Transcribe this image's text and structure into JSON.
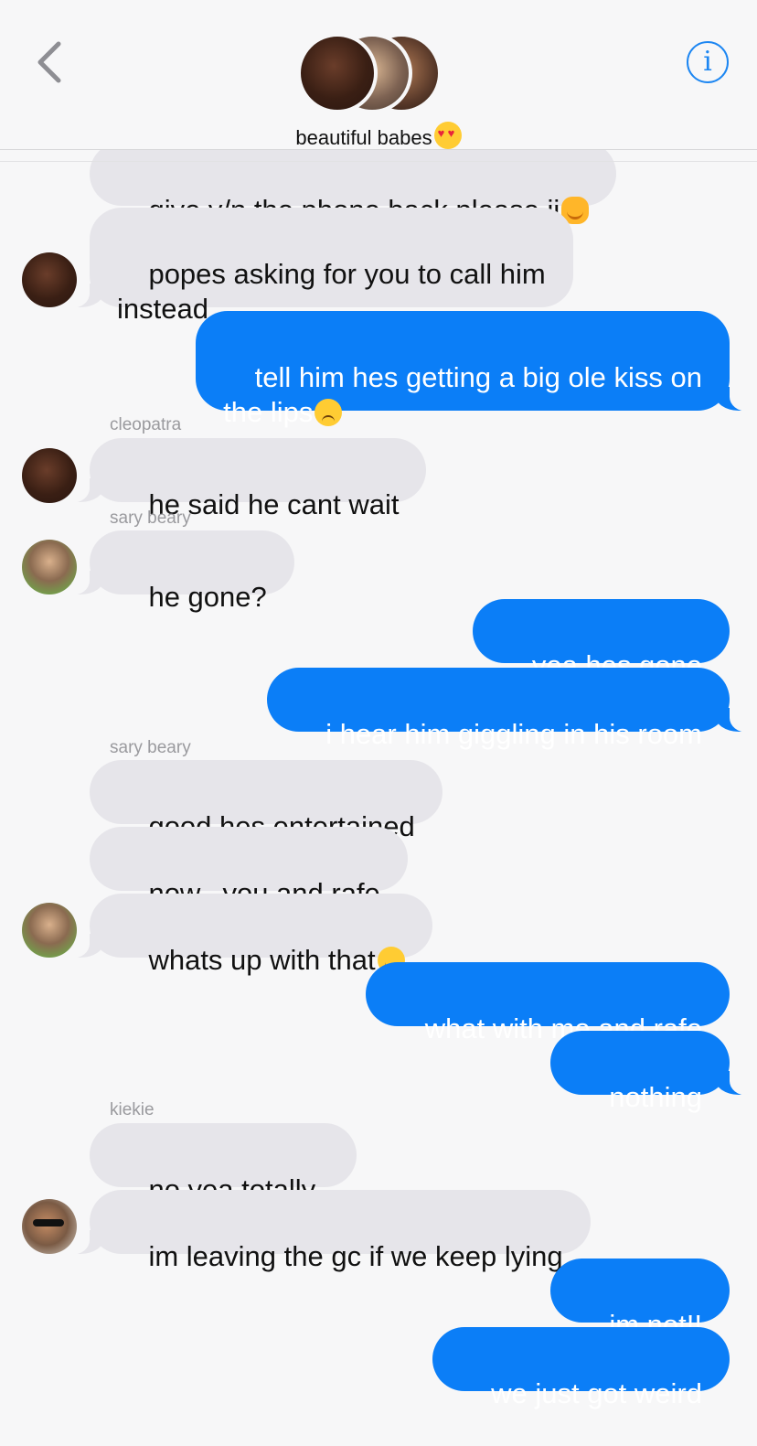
{
  "header": {
    "group_name": "beautiful babes",
    "group_emoji": "smiling-face-with-heart-eyes-emoji",
    "back_icon": "chevron-left-icon",
    "info_icon": "info-icon",
    "info_glyph": "i"
  },
  "colors": {
    "outgoing_bubble": "#0b7ef7",
    "incoming_bubble": "#e6e5ea",
    "accent": "#1c86f2"
  },
  "messages": [
    {
      "dir": "in",
      "text": "give y/n the phone back please jj",
      "emoji": "hugging-face-emoji"
    },
    {
      "dir": "in",
      "text": "popes asking for you to call him\ninstead"
    },
    {
      "dir": "out",
      "text": "tell him hes getting a big ole kiss on\nthe lips",
      "emoji": "pensive-face-emoji"
    },
    {
      "dir": "in",
      "sender": "cleopatra",
      "text": "he said he cant wait"
    },
    {
      "dir": "in",
      "sender": "sary beary",
      "text": "he gone?"
    },
    {
      "dir": "out",
      "text": "yea hes gone"
    },
    {
      "dir": "out",
      "text": "i hear him giggling in his room"
    },
    {
      "dir": "in",
      "sender": "sary beary",
      "text": "good hes entertained"
    },
    {
      "dir": "in",
      "text": "now.. you and rafe"
    },
    {
      "dir": "in",
      "text": "whats up with that",
      "emoji": "smiling-face-emoji"
    },
    {
      "dir": "out",
      "text": "what with me and rafe"
    },
    {
      "dir": "out",
      "text": "nothing"
    },
    {
      "dir": "in",
      "sender": "kiekie",
      "text": "no yea totally.."
    },
    {
      "dir": "in",
      "text": "im leaving the gc if we keep lying"
    },
    {
      "dir": "out",
      "text": "im not!!"
    },
    {
      "dir": "out",
      "text": "we just got weird"
    }
  ]
}
